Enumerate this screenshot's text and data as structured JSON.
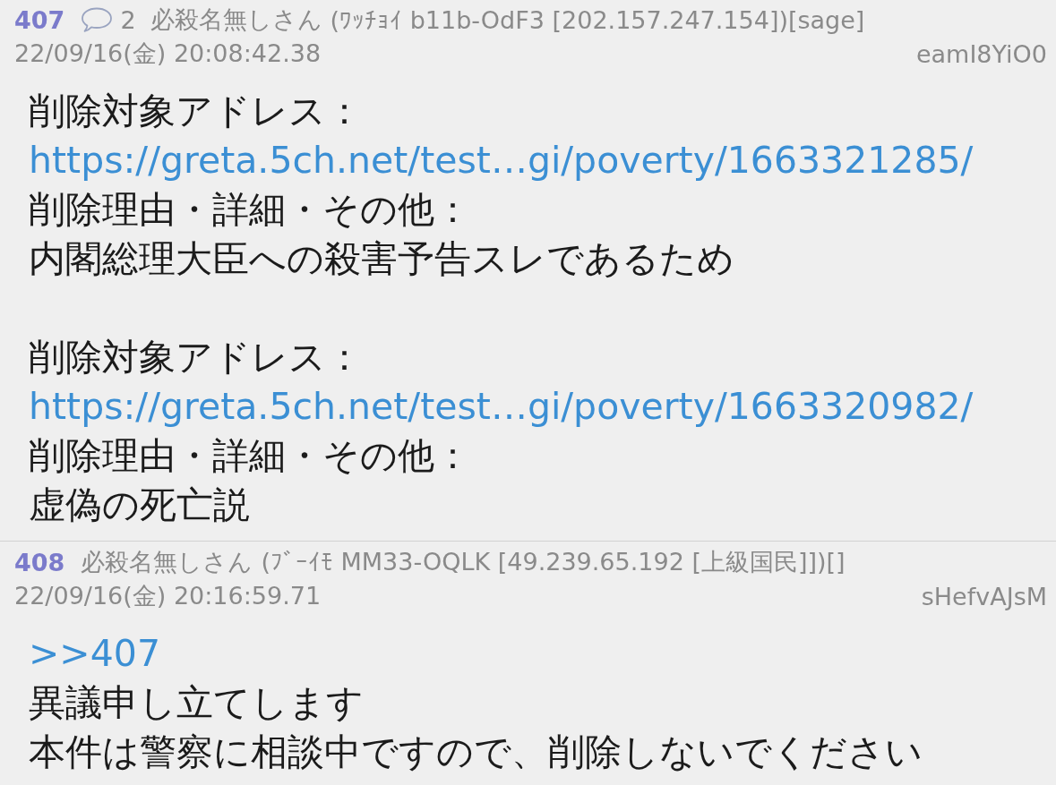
{
  "posts": [
    {
      "number": "407",
      "reply_count": "2",
      "name": "必殺名無しさん",
      "info": "(ﾜｯﾁｮｲ b11b-OdF3 [202.157.247.154])[sage]",
      "date": "22/09/16(金) 20:08:42.38",
      "id": "eamI8YiO0",
      "paragraphs": [
        {
          "lines": [
            {
              "kind": "text",
              "text": "削除対象アドレス："
            },
            {
              "kind": "link",
              "text": "https://greta.5ch.net/test…gi/poverty/1663321285/"
            },
            {
              "kind": "text",
              "text": "削除理由・詳細・その他："
            },
            {
              "kind": "text",
              "text": "内閣総理大臣への殺害予告スレであるため"
            }
          ]
        },
        {
          "lines": [
            {
              "kind": "text",
              "text": "削除対象アドレス："
            },
            {
              "kind": "link",
              "text": "https://greta.5ch.net/test…gi/poverty/1663320982/"
            },
            {
              "kind": "text",
              "text": "削除理由・詳細・その他："
            },
            {
              "kind": "text",
              "text": "虚偽の死亡説"
            }
          ]
        }
      ]
    },
    {
      "number": "408",
      "name": "必殺名無しさん",
      "info": "(ﾌﾞｰｲﾓ MM33-OQLK [49.239.65.192 [上級国民]])[]",
      "date": "22/09/16(金) 20:16:59.71",
      "id": "sHefvAJsM",
      "paragraphs": [
        {
          "lines": [
            {
              "kind": "link",
              "text": ">>407"
            },
            {
              "kind": "text",
              "text": "異議申し立てします"
            },
            {
              "kind": "text",
              "text": "本件は警察に相談中ですので、削除しないでください"
            }
          ]
        }
      ]
    }
  ]
}
